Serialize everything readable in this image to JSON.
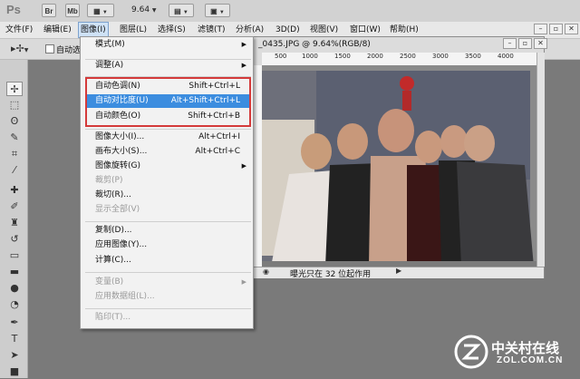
{
  "app": {
    "logo": "Ps",
    "bridge_label": "Br",
    "mini_bridge_label": "Mb",
    "zoom": "9.64"
  },
  "menubar": {
    "items": [
      "文件(F)",
      "编辑(E)",
      "图像(I)",
      "图层(L)",
      "选择(S)",
      "滤镜(T)",
      "分析(A)",
      "3D(D)",
      "视图(V)",
      "窗口(W)",
      "帮助(H)"
    ],
    "active": "图像(I)"
  },
  "options_bar": {
    "auto_select_label": "自动选"
  },
  "document": {
    "title": "_0435.JPG @ 9.64%(RGB/8)",
    "ruler_ticks": [
      "500",
      "1000",
      "1500",
      "2000",
      "2500",
      "3000",
      "3500",
      "4000"
    ],
    "status": "曝光只在 32 位起作用"
  },
  "image_menu": {
    "items": [
      {
        "label": "模式(M)",
        "shortcut": "",
        "submenu": true,
        "disabled": false
      },
      {
        "label": "调整(A)",
        "shortcut": "",
        "submenu": true,
        "disabled": false
      },
      {
        "label": "自动色调(N)",
        "shortcut": "Shift+Ctrl+L",
        "submenu": false,
        "disabled": false
      },
      {
        "label": "自动对比度(U)",
        "shortcut": "Alt+Shift+Ctrl+L",
        "submenu": false,
        "disabled": false,
        "highlighted": true
      },
      {
        "label": "自动颜色(O)",
        "shortcut": "Shift+Ctrl+B",
        "submenu": false,
        "disabled": false
      },
      {
        "label": "图像大小(I)...",
        "shortcut": "Alt+Ctrl+I",
        "submenu": false,
        "disabled": false
      },
      {
        "label": "画布大小(S)...",
        "shortcut": "Alt+Ctrl+C",
        "submenu": false,
        "disabled": false
      },
      {
        "label": "图像旋转(G)",
        "shortcut": "",
        "submenu": true,
        "disabled": false
      },
      {
        "label": "裁剪(P)",
        "shortcut": "",
        "submenu": false,
        "disabled": true
      },
      {
        "label": "裁切(R)...",
        "shortcut": "",
        "submenu": false,
        "disabled": false
      },
      {
        "label": "显示全部(V)",
        "shortcut": "",
        "submenu": false,
        "disabled": true
      },
      {
        "label": "复制(D)...",
        "shortcut": "",
        "submenu": false,
        "disabled": false
      },
      {
        "label": "应用图像(Y)...",
        "shortcut": "",
        "submenu": false,
        "disabled": false
      },
      {
        "label": "计算(C)...",
        "shortcut": "",
        "submenu": false,
        "disabled": false
      },
      {
        "label": "变量(B)",
        "shortcut": "",
        "submenu": true,
        "disabled": true
      },
      {
        "label": "应用数据组(L)...",
        "shortcut": "",
        "submenu": false,
        "disabled": true
      },
      {
        "label": "陷印(T)...",
        "shortcut": "",
        "submenu": false,
        "disabled": true
      }
    ]
  },
  "watermark": {
    "text": "中关村在线",
    "sub": "ZOL.COM.CN"
  },
  "colors": {
    "highlight": "#3c8ddf",
    "annotation_box": "#d43a3a",
    "workspace": "#7a7a7a"
  }
}
